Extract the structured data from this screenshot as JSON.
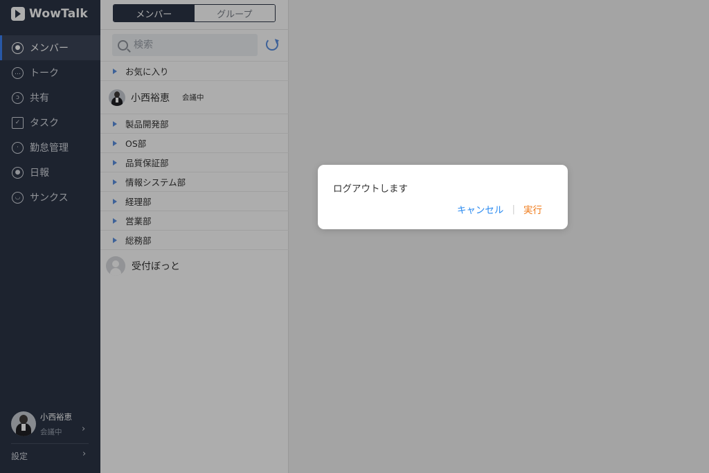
{
  "app": {
    "name": "WowTalk"
  },
  "nav": {
    "items": [
      {
        "label": "メンバー",
        "icon": "person-icon",
        "active": true
      },
      {
        "label": "トーク",
        "icon": "chat-bubble-icon",
        "active": false
      },
      {
        "label": "共有",
        "icon": "rss-icon",
        "active": false
      },
      {
        "label": "タスク",
        "icon": "clipboard-check-icon",
        "active": false
      },
      {
        "label": "勤怠管理",
        "icon": "clock-icon",
        "active": false
      },
      {
        "label": "日報",
        "icon": "report-icon",
        "active": false
      },
      {
        "label": "サンクス",
        "icon": "smile-icon",
        "active": false
      }
    ],
    "profile": {
      "name": "小西裕恵",
      "status": "会議中"
    },
    "settings_label": "設定"
  },
  "panel": {
    "tabs": [
      {
        "label": "メンバー",
        "active": true
      },
      {
        "label": "グループ",
        "active": false
      }
    ],
    "search": {
      "placeholder": "検索"
    },
    "favorites": "お気に入り",
    "current_member": {
      "name": "小西裕恵",
      "status": "会議中"
    },
    "groups": [
      "製品開発部",
      "OS部",
      "品質保証部",
      "情報システム部",
      "経理部",
      "営業部",
      "総務部"
    ],
    "bot": {
      "name": "受付ぼっと"
    }
  },
  "dialog": {
    "message": "ログアウトします",
    "cancel_label": "キャンセル",
    "separator": "|",
    "confirm_label": "実行"
  },
  "colors": {
    "sidebar_bg": "#2b3446",
    "accent_blue": "#2a8af0",
    "confirm_orange": "#f07b1a",
    "overlay": "rgba(0,0,0,0.32)"
  }
}
